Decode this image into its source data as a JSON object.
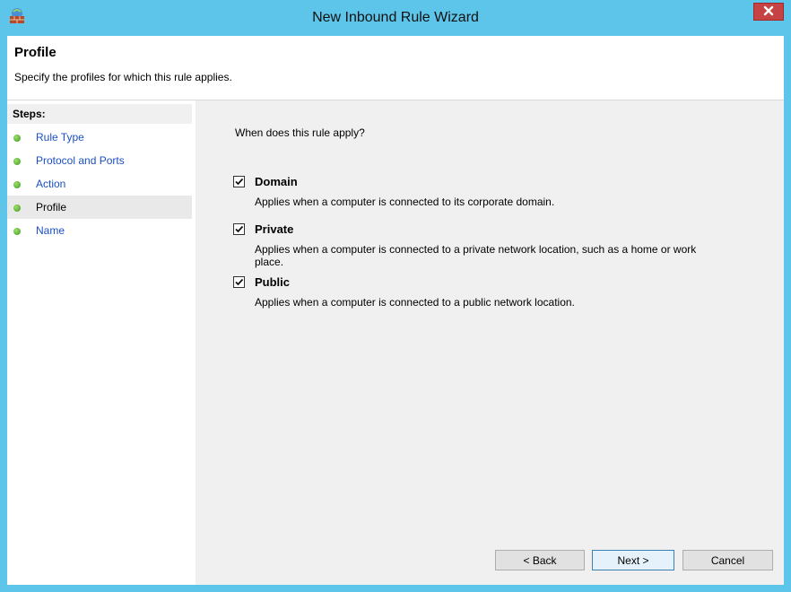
{
  "window": {
    "title": "New Inbound Rule Wizard",
    "icon": "firewall-icon",
    "close_icon": "close-icon"
  },
  "header": {
    "title": "Profile",
    "subtitle": "Specify the profiles for which this rule applies."
  },
  "steps": {
    "heading": "Steps:",
    "items": [
      {
        "label": "Rule Type",
        "current": false
      },
      {
        "label": "Protocol and Ports",
        "current": false
      },
      {
        "label": "Action",
        "current": false
      },
      {
        "label": "Profile",
        "current": true
      },
      {
        "label": "Name",
        "current": false
      }
    ]
  },
  "content": {
    "question": "When does this rule apply?",
    "options": [
      {
        "label": "Domain",
        "checked": true,
        "description": "Applies when a computer is connected to its corporate domain."
      },
      {
        "label": "Private",
        "checked": true,
        "description": "Applies when a computer is connected to a private network location, such as a home or work place."
      },
      {
        "label": "Public",
        "checked": true,
        "description": "Applies when a computer is connected to a public network location."
      }
    ]
  },
  "buttons": {
    "back": "< Back",
    "next": "Next >",
    "cancel": "Cancel"
  },
  "colors": {
    "frame": "#5dc5ea",
    "close": "#c74242",
    "link": "#1a4fc4",
    "panel": "#f0f0f0"
  }
}
